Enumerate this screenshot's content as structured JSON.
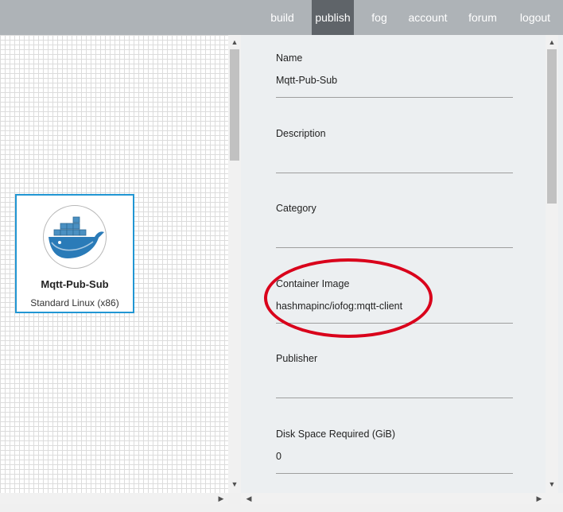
{
  "nav": {
    "items": [
      {
        "label": "build"
      },
      {
        "label": "publish",
        "active": true
      },
      {
        "label": "fog"
      },
      {
        "label": "account"
      },
      {
        "label": "forum"
      },
      {
        "label": "logout"
      }
    ]
  },
  "card": {
    "icon": "docker-whale-icon",
    "title": "Mqtt-Pub-Sub",
    "subtitle": "Standard Linux (x86)"
  },
  "form": {
    "name": {
      "label": "Name",
      "value": "Mqtt-Pub-Sub"
    },
    "description": {
      "label": "Description",
      "value": ""
    },
    "category": {
      "label": "Category",
      "value": ""
    },
    "container_image": {
      "label": "Container Image",
      "value": "hashmapinc/iofog:mqtt-client"
    },
    "publisher": {
      "label": "Publisher",
      "value": ""
    },
    "disk_space": {
      "label": "Disk Space Required (GiB)",
      "value": "0"
    }
  },
  "colors": {
    "nav_bg": "#aeb3b7",
    "nav_active": "#5f6469",
    "card_border": "#2196d3",
    "highlight_circle": "#d9001b"
  }
}
